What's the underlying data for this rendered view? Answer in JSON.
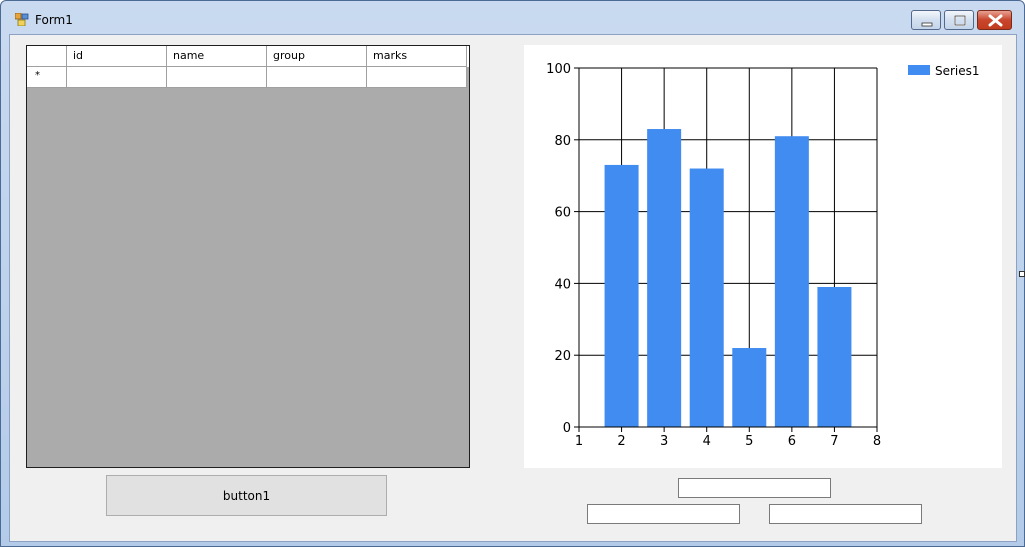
{
  "window": {
    "title": "Form1",
    "icon": "winforms-app-icon"
  },
  "grid": {
    "columns": [
      "id",
      "name",
      "group",
      "marks"
    ],
    "new_row_marker": "*",
    "rows": []
  },
  "chart_data": {
    "type": "bar",
    "categories": [
      2,
      3,
      4,
      5,
      6,
      7
    ],
    "series": [
      {
        "name": "Series1",
        "values": [
          73,
          83,
          72,
          22,
          81,
          39
        ],
        "color": "#418cf0"
      }
    ],
    "xlim": [
      1,
      8
    ],
    "ylim": [
      0,
      100
    ],
    "xticks": [
      "1",
      "2",
      "3",
      "4",
      "5",
      "6",
      "7",
      "8"
    ],
    "yticks": [
      "0",
      "20",
      "40",
      "60",
      "80",
      "100"
    ],
    "grid": true,
    "legend": "top-right",
    "title": "",
    "xlabel": "",
    "ylabel": ""
  },
  "controls": {
    "button1_label": "button1",
    "textbox1_value": "",
    "textbox2_value": "",
    "textbox3_value": ""
  },
  "colors": {
    "bar": "#418cf0",
    "grid_background": "#ababab",
    "client_background": "#f0f0f0",
    "close_button": "#c9462c"
  }
}
